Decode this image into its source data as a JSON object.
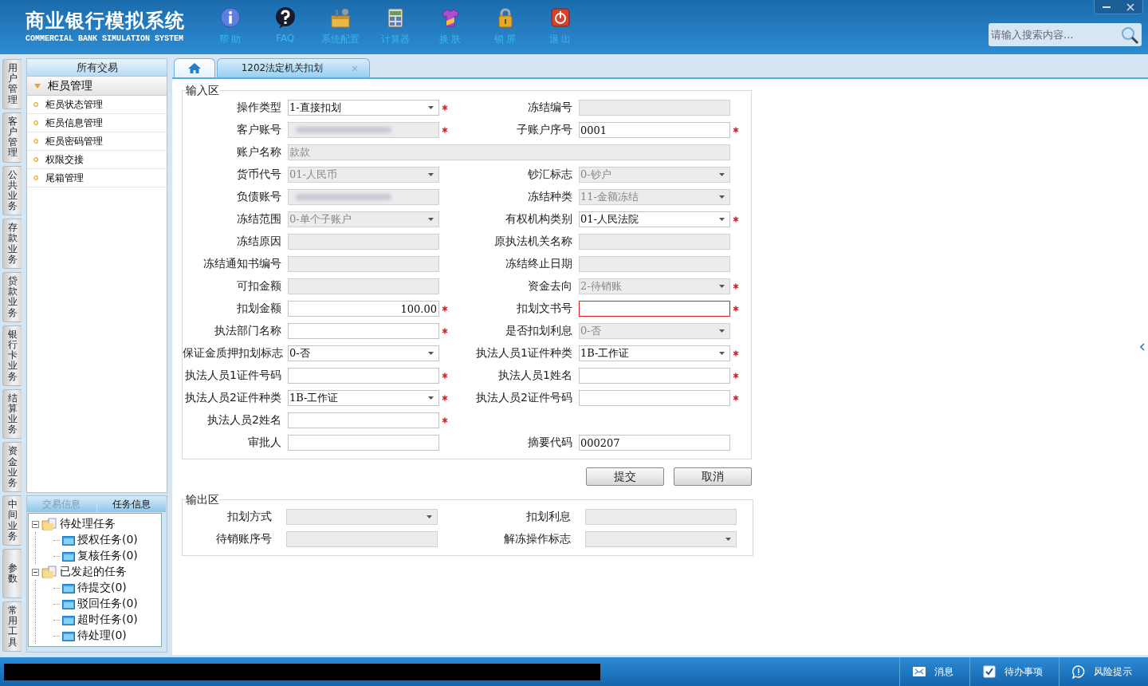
{
  "header": {
    "title": "商业银行模拟系统",
    "subtitle": "COMMERCIAL BANK SIMULATION SYSTEM",
    "toolbar": [
      {
        "label": "帮 助"
      },
      {
        "label": "FAQ"
      },
      {
        "label": "系统配置"
      },
      {
        "label": "计算器"
      },
      {
        "label": "换 肤"
      },
      {
        "label": "锁 屏"
      },
      {
        "label": "退 出"
      }
    ],
    "search": {
      "placeholder": "请输入搜索内容..."
    }
  },
  "side_tabs": [
    "用户管理",
    "客户管理",
    "公共业务",
    "存款业务",
    "贷款业务",
    "银行卡业务",
    "结算业务",
    "资金业务",
    "中间业务",
    "参数",
    "常用工具"
  ],
  "nav": {
    "title": "所有交易",
    "group": {
      "label": "柜员管理",
      "expanded": true,
      "items": [
        "柜员状态管理",
        "柜员信息管理",
        "柜员密码管理",
        "权限交接",
        "尾箱管理"
      ]
    }
  },
  "task_panel": {
    "tabs": [
      {
        "label": "交易信息",
        "selected": false
      },
      {
        "label": "任务信息",
        "selected": true
      }
    ],
    "tree": [
      {
        "label": "待处理任务",
        "expanded": true,
        "children": [
          {
            "label": "授权任务(0)"
          },
          {
            "label": "复核任务(0)"
          }
        ]
      },
      {
        "label": "已发起的任务",
        "expanded": true,
        "children": [
          {
            "label": "待提交(0)"
          },
          {
            "label": "驳回任务(0)"
          },
          {
            "label": "超时任务(0)"
          },
          {
            "label": "待处理(0)"
          }
        ]
      }
    ]
  },
  "tabs": [
    {
      "kind": "home",
      "selected": false
    },
    {
      "kind": "page",
      "label": "1202法定机关扣划",
      "selected": true
    }
  ],
  "sections": [
    {
      "kind": "input",
      "title": "输入区",
      "rows": [
        [
          {
            "label": "操作类型",
            "kind": "select",
            "value": "1-直接扣划",
            "disabled": false,
            "required": true
          },
          {
            "label": "冻结编号",
            "kind": "text",
            "disabled": true
          }
        ],
        [
          {
            "label": "客户账号",
            "kind": "text",
            "disabled": true,
            "redacted": true,
            "required": true
          },
          {
            "label": "子账户序号",
            "kind": "text",
            "value": "0001",
            "disabled": false,
            "required": true
          }
        ],
        [
          {
            "label": "账户名称",
            "kind": "text",
            "value": "款款",
            "disabled": true,
            "wide": true
          }
        ],
        [
          {
            "label": "货币代号",
            "kind": "select",
            "value": "01-人民币",
            "disabled": true
          },
          {
            "label": "钞汇标志",
            "kind": "select",
            "value": "0-钞户",
            "disabled": true
          }
        ],
        [
          {
            "label": "负债账号",
            "kind": "text",
            "disabled": true,
            "redacted": true
          },
          {
            "label": "冻结种类",
            "kind": "select",
            "value": "11-金额冻结",
            "disabled": true
          }
        ],
        [
          {
            "label": "冻结范围",
            "kind": "select",
            "value": "0-单个子账户",
            "disabled": true
          },
          {
            "label": "有权机构类别",
            "kind": "select",
            "value": "01-人民法院",
            "disabled": false,
            "required": true
          }
        ],
        [
          {
            "label": "冻结原因",
            "kind": "text",
            "disabled": true
          },
          {
            "label": "原执法机关名称",
            "kind": "text",
            "disabled": true
          }
        ],
        [
          {
            "label": "冻结通知书编号",
            "kind": "text",
            "disabled": true
          },
          {
            "label": "冻结终止日期",
            "kind": "text",
            "disabled": true
          }
        ],
        [
          {
            "label": "可扣金额",
            "kind": "text",
            "disabled": true
          },
          {
            "label": "资金去向",
            "kind": "select",
            "value": "2-待销账",
            "disabled": true,
            "required": true
          }
        ],
        [
          {
            "label": "扣划金额",
            "kind": "amount",
            "value": "100.00",
            "disabled": false,
            "required": true
          },
          {
            "label": "扣划文书号",
            "kind": "text",
            "disabled": false,
            "required": true,
            "error": true
          }
        ],
        [
          {
            "label": "执法部门名称",
            "kind": "text",
            "disabled": false,
            "required": true
          },
          {
            "label": "是否扣划利息",
            "kind": "select",
            "value": "0-否",
            "disabled": true
          }
        ],
        [
          {
            "label": "保证金质押扣划标志",
            "kind": "select",
            "value": "0-否",
            "disabled": false
          },
          {
            "label": "执法人员1证件种类",
            "kind": "select",
            "value": "1B-工作证",
            "disabled": false,
            "required": true
          }
        ],
        [
          {
            "label": "执法人员1证件号码",
            "kind": "text",
            "disabled": false,
            "required": true
          },
          {
            "label": "执法人员1姓名",
            "kind": "text",
            "disabled": false,
            "required": true
          }
        ],
        [
          {
            "label": "执法人员2证件种类",
            "kind": "select",
            "value": "1B-工作证",
            "disabled": false,
            "required": true
          },
          {
            "label": "执法人员2证件号码",
            "kind": "text",
            "disabled": false,
            "required": true
          }
        ],
        [
          {
            "label": "执法人员2姓名",
            "kind": "text",
            "disabled": false,
            "required": true
          }
        ],
        [
          {
            "label": "审批人",
            "kind": "text",
            "disabled": false
          },
          {
            "label": "摘要代码",
            "kind": "text",
            "value": "000207",
            "disabled": false
          }
        ]
      ],
      "buttons": [
        "提交",
        "取消"
      ]
    },
    {
      "kind": "output",
      "title": "输出区",
      "rows": [
        [
          {
            "label": "扣划方式",
            "kind": "select",
            "disabled": true
          },
          {
            "label": "扣划利息",
            "kind": "text",
            "disabled": true
          }
        ],
        [
          {
            "label": "待销账序号",
            "kind": "text",
            "disabled": true
          },
          {
            "label": "解冻操作标志",
            "kind": "select",
            "disabled": true
          }
        ]
      ]
    }
  ],
  "status_bar": {
    "items": [
      "消息",
      "待办事项",
      "风险提示"
    ]
  }
}
